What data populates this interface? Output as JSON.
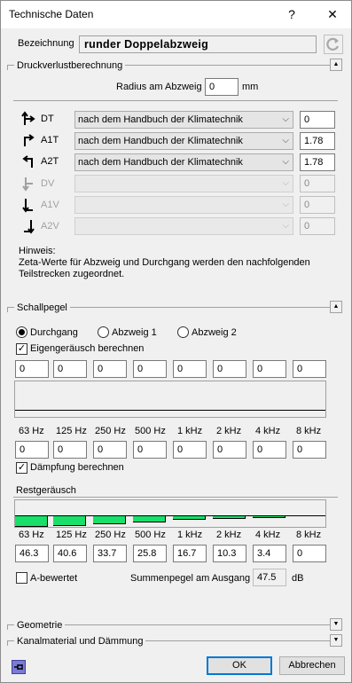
{
  "window": {
    "title": "Technische Daten",
    "help": "?",
    "close": "✕"
  },
  "bezeichnung": {
    "label": "Bezeichnung",
    "value": "runder Doppelabzweig"
  },
  "druckverlust": {
    "title": "Druckverlustberechnung",
    "radius_label": "Radius am Abzweig",
    "radius_value": "0",
    "radius_unit": "mm",
    "rows": [
      {
        "label": "DT",
        "select": "nach dem Handbuch der Klimatechnik",
        "value": "0",
        "enabled": true
      },
      {
        "label": "A1T",
        "select": "nach dem Handbuch der Klimatechnik",
        "value": "1.78",
        "enabled": true
      },
      {
        "label": "A2T",
        "select": "nach dem Handbuch der Klimatechnik",
        "value": "1.78",
        "enabled": true
      },
      {
        "label": "DV",
        "select": "",
        "value": "0",
        "enabled": false
      },
      {
        "label": "A1V",
        "select": "",
        "value": "0",
        "enabled": false
      },
      {
        "label": "A2V",
        "select": "",
        "value": "0",
        "enabled": false
      }
    ],
    "hint_lines": [
      "Hinweis:",
      "Zeta-Werte für Abzweig und Durchgang werden den nachfolgenden",
      "Teilstrecken zugeordnet."
    ]
  },
  "schallpegel": {
    "title": "Schallpegel",
    "radios": [
      {
        "label": "Durchgang",
        "selected": true
      },
      {
        "label": "Abzweig 1",
        "selected": false
      },
      {
        "label": "Abzweig 2",
        "selected": false
      }
    ],
    "eigen_label": "Eigengeräusch berechnen",
    "eigen_checked": true,
    "eigen_top_values": [
      "0",
      "0",
      "0",
      "0",
      "0",
      "0",
      "0",
      "0"
    ],
    "frequencies": [
      "63 Hz",
      "125 Hz",
      "250 Hz",
      "500 Hz",
      "1 kHz",
      "2 kHz",
      "4 kHz",
      "8 kHz"
    ],
    "eigen_bottom_values": [
      "0",
      "0",
      "0",
      "0",
      "0",
      "0",
      "0",
      "0"
    ],
    "daempfung_label": "Dämpfung berechnen",
    "daempfung_checked": true,
    "rest_label": "Restgeräusch",
    "rest_frequencies": [
      "63 Hz",
      "125 Hz",
      "250 Hz",
      "500 Hz",
      "1 kHz",
      "2 kHz",
      "4 kHz",
      "8 kHz"
    ],
    "rest_values": [
      "46.3",
      "40.6",
      "33.7",
      "25.8",
      "16.7",
      "10.3",
      "3.4",
      "0"
    ],
    "bar_color": "#19e06a",
    "a_bewertet_label": "A-bewertet",
    "a_bewertet_checked": false,
    "summe_label": "Summenpegel am Ausgang",
    "summe_value": "47.5",
    "summe_unit": "dB"
  },
  "geometrie": {
    "title": "Geometrie"
  },
  "kanalmaterial": {
    "title": "Kanalmaterial und Dämmung"
  },
  "buttons": {
    "ok": "OK",
    "cancel": "Abbrechen"
  },
  "icons": {
    "pin": "pin-icon",
    "refresh": "refresh-icon"
  }
}
